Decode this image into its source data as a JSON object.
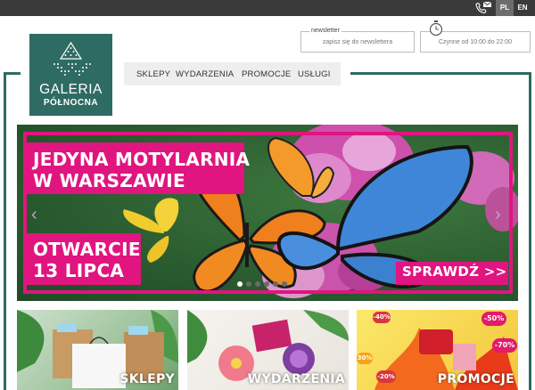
{
  "topbar": {
    "lang_pl": "PL",
    "lang_en": "EN",
    "contact_icon": "phone-mail-icon"
  },
  "logo": {
    "line1": "GALERIA",
    "line2": "PÓŁNOCNA",
    "bg_color": "#2e6b62"
  },
  "newsletter": {
    "label": "newsletter",
    "placeholder": "zapisz się do newslettera"
  },
  "hours": {
    "icon": "clock-icon",
    "text": "Czynne od 10:00 do 22:00"
  },
  "nav": {
    "items": [
      "SKLEPY",
      "WYDARZENIA",
      "PROMOCJE",
      "USŁUGI"
    ]
  },
  "hero": {
    "line1": "JEDYNA MOTYLARNIA",
    "line2": "W WARSZAWIE",
    "line3": "OTWARCIE",
    "line4": "13 LIPCA",
    "cta": "SPRAWDŹ >>",
    "accent_color": "#e0157f",
    "prev_icon": "chevron-left-icon",
    "next_icon": "chevron-right-icon",
    "slide_count": 6,
    "active_slide": 1
  },
  "tiles": [
    {
      "label": "SKLEPY"
    },
    {
      "label": "WYDARZENIA"
    },
    {
      "label": "PROMOCJE"
    }
  ],
  "promo_badges": [
    "-50%",
    "-40%",
    "-70%",
    "30%",
    "-20%"
  ]
}
